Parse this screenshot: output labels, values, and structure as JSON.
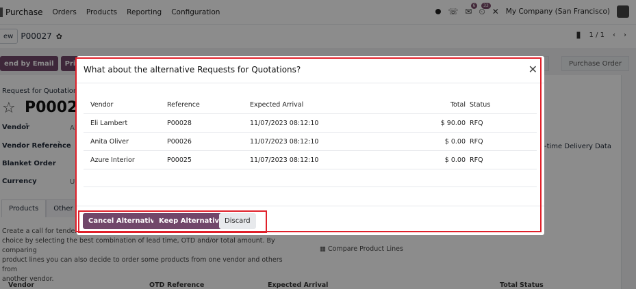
{
  "topnav": {
    "app_name": "Purchase",
    "menu": [
      "Orders",
      "Products",
      "Reporting",
      "Configuration"
    ],
    "badge_messages": "6",
    "badge_activities": "33",
    "company": "My Company (San Francisco)"
  },
  "control": {
    "new_label": "ew",
    "record_name": "P00027",
    "pager": "1 / 1"
  },
  "form": {
    "actions": [
      "end by Email",
      "Print RF"
    ],
    "statuses": [
      "nt",
      "Purchase Order"
    ],
    "title_label": "Request for Quotation",
    "title": "P00027",
    "fields": [
      "Vendor",
      "Vendor Reference",
      "Blanket Order",
      "Currency"
    ],
    "field_help_mark": "?",
    "vendor_value_partial": "Al",
    "currency_value_partial": "U:",
    "right_field": "-time Delivery Data",
    "tabs": [
      "Products",
      "Other In"
    ],
    "description": "Create a call for tender b... choice by selecting the best combination of lead time, OTD and/or total amount. By comparing product lines you can also decide to order some products from one vendor and others from another vendor.",
    "description_lines": [
      "Create a call for tender b",
      "choice by selecting the best combination of lead time, OTD and/or total amount. By comparing",
      "product lines you can also decide to order some products from one vendor and others from",
      "another vendor."
    ],
    "compare_link": "Compare Product Lines",
    "bottom_headers": [
      "Vendor",
      "OTD",
      "Reference",
      "Expected Arrival",
      "Total",
      "Status"
    ]
  },
  "modal": {
    "title": "What about the alternative Requests for Quotations?",
    "columns": [
      "Vendor",
      "Reference",
      "Expected Arrival",
      "Total",
      "Status"
    ],
    "rows": [
      {
        "vendor": "Eli Lambert",
        "reference": "P00028",
        "expected": "11/07/2023 08:12:10",
        "total": "$ 90.00",
        "status": "RFQ"
      },
      {
        "vendor": "Anita Oliver",
        "reference": "P00026",
        "expected": "11/07/2023 08:12:10",
        "total": "$ 0.00",
        "status": "RFQ"
      },
      {
        "vendor": "Azure Interior",
        "reference": "P00025",
        "expected": "11/07/2023 08:12:10",
        "total": "$ 0.00",
        "status": "RFQ"
      }
    ],
    "buttons": {
      "cancel": "Cancel Alternatives",
      "keep": "Keep Alternatives",
      "discard": "Discard"
    }
  },
  "colors": {
    "primary": "#71476a",
    "highlight": "#e0202a"
  }
}
